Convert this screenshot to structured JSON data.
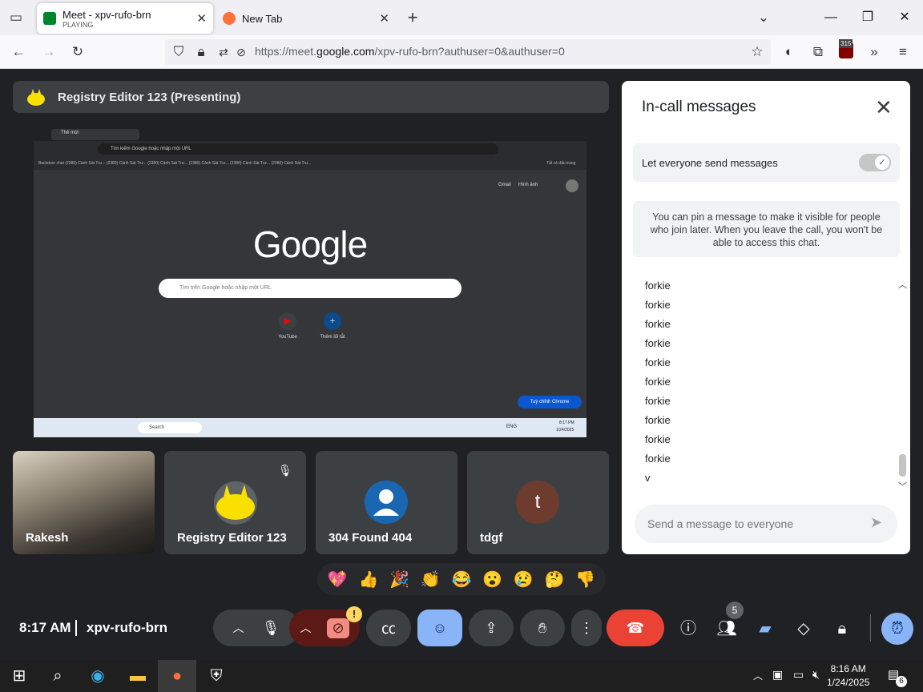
{
  "browser": {
    "tabs": [
      {
        "title": "Meet - xpv-rufo-brn",
        "subtitle": "PLAYING"
      },
      {
        "title": "New Tab"
      }
    ],
    "url_prefix": "https://meet.",
    "url_domain": "google.com",
    "url_path": "/xpv-rufo-brn?authuser=0&authuser=0",
    "extension_badge": "315"
  },
  "presenting": {
    "label": "Registry Editor 123 (Presenting)"
  },
  "shared_screen": {
    "tab_title": "Thẻ mới",
    "omnibox": "Tìm kiếm Google hoặc nhập một URL",
    "bookmarks": "Backdoor chat   (2380) Cảnh Sát Trư...   (2380) Cảnh Sát Trư...   (2380) Cảnh Sát Trư...   (2380) Cảnh Sát Trư...   (2380) Cảnh Sát Trư...   (2380) Cảnh Sát Trư...",
    "all_bookmarks": "Tất cả dấu trang",
    "gmail": "Gmail",
    "images": "Hình ảnh",
    "logo": "Google",
    "search_placeholder": "Tìm trên Google hoặc nhập một URL",
    "shortcut1": "YouTube",
    "shortcut2": "Thêm lối tắt",
    "customize": "Tuỳ chỉnh Chrome",
    "task_search": "Search",
    "task_lang": "ENG",
    "task_time": "8:17 PM",
    "task_date": "1/24/2025"
  },
  "participants": [
    {
      "name": "Rakesh"
    },
    {
      "name": "Registry Editor 123"
    },
    {
      "name": "304 Found 404"
    },
    {
      "name": "tdgf",
      "initial": "t"
    }
  ],
  "reactions": [
    "💖",
    "👍",
    "🎉",
    "👏",
    "😂",
    "😮",
    "😢",
    "🤔",
    "👎"
  ],
  "bottom": {
    "time": "8:17 AM",
    "meeting_code": "xpv-rufo-brn",
    "people_count": "5",
    "camera_alert": "!"
  },
  "chat": {
    "title": "In-call messages",
    "let_everyone": "Let everyone send messages",
    "pin_info": "You can pin a message to make it visible for people who join later. When you leave the call, you won't be able to access this chat.",
    "messages": [
      "forkie",
      "forkie",
      "forkie",
      "forkie",
      "forkie",
      "forkie",
      "forkie",
      "forkie",
      "forkie",
      "forkie",
      "v"
    ],
    "placeholder": "Send a message to everyone"
  },
  "taskbar": {
    "time": "8:16 AM",
    "date": "1/24/2025",
    "notif_count": "6"
  },
  "colors": {
    "end_call": "#ea4335",
    "accent": "#8ab4f8",
    "camera_off": "#f28b82"
  }
}
